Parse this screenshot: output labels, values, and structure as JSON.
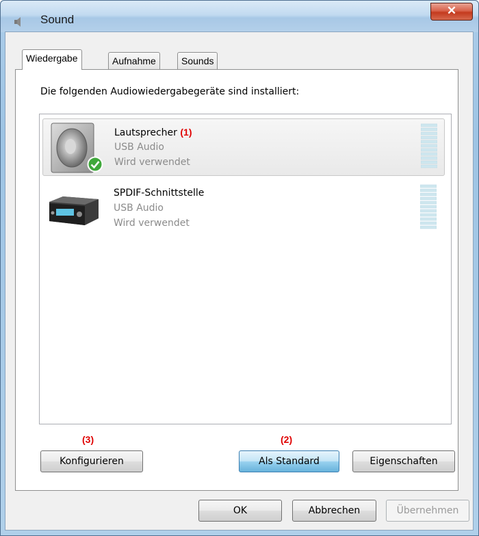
{
  "window": {
    "title": "Sound",
    "close_glyph": "✕"
  },
  "tabs": [
    {
      "label": "Wiedergabe",
      "active": true
    },
    {
      "label": "Aufnahme",
      "active": false
    },
    {
      "label": "Sounds",
      "active": false
    }
  ],
  "playback": {
    "instructions": "Die folgenden Audiowiedergabegeräte sind installiert:",
    "devices": [
      {
        "name": "Lautsprecher",
        "annotation": "(1)",
        "driver": "USB Audio",
        "status": "Wird verwendet",
        "icon": "speaker-icon",
        "default_badge": "check-icon",
        "selected": true
      },
      {
        "name": "SPDIF-Schnittstelle",
        "annotation": "",
        "driver": "USB Audio",
        "status": "Wird verwendet",
        "icon": "receiver-icon",
        "selected": false
      }
    ]
  },
  "panel_buttons": {
    "configure": {
      "label": "Konfigurieren",
      "annotation": "(3)"
    },
    "set_default": {
      "label": "Als Standard",
      "annotation": "(2)"
    },
    "properties": {
      "label": "Eigenschaften"
    }
  },
  "dialog_buttons": {
    "ok": "OK",
    "cancel": "Abbrechen",
    "apply": "Übernehmen"
  },
  "colors": {
    "annotation": "#e00000",
    "secondary_text": "#8b8b8b",
    "meter": "#cfe7ef"
  }
}
